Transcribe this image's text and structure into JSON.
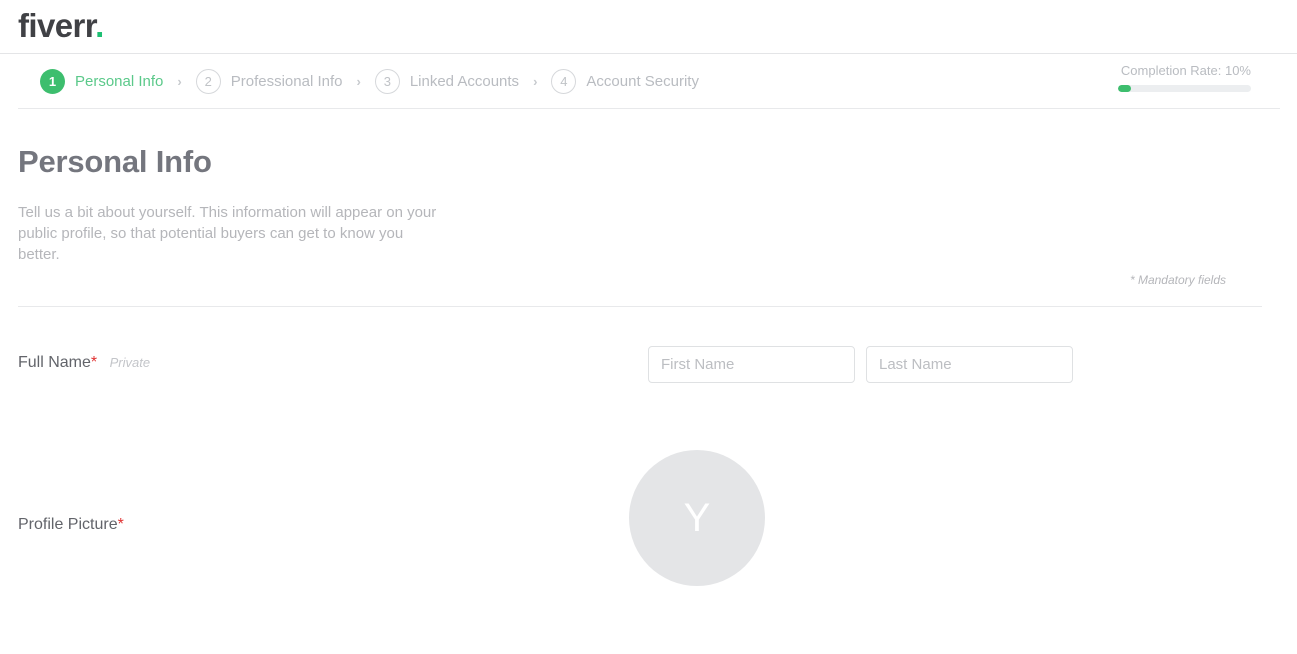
{
  "header": {
    "logo_text": "fiverr",
    "logo_dot": ".",
    "brand_green": "#1dbf73"
  },
  "steps": [
    {
      "number": "1",
      "label": "Personal Info",
      "state": "active"
    },
    {
      "number": "2",
      "label": "Professional Info",
      "state": "inactive"
    },
    {
      "number": "3",
      "label": "Linked Accounts",
      "state": "inactive"
    },
    {
      "number": "4",
      "label": "Account Security",
      "state": "inactive"
    }
  ],
  "step_separator": "›",
  "completion": {
    "label": "Completion Rate: 10%",
    "percent": 10,
    "fill_color": "#3dbe6e",
    "track_color": "#eceef0"
  },
  "main": {
    "title": "Personal Info",
    "description": "Tell us a bit about yourself. This information will appear on your public profile, so that potential buyers can get to know you better.",
    "mandatory_note": "* Mandatory fields"
  },
  "fields": {
    "full_name": {
      "label": "Full Name",
      "required_mark": "*",
      "privacy_tag": "Private",
      "first_name_placeholder": "First Name",
      "first_name_value": "",
      "last_name_placeholder": "Last Name",
      "last_name_value": ""
    },
    "profile_picture": {
      "label": "Profile Picture",
      "required_mark": "*",
      "avatar_initial": "Y",
      "avatar_bg": "#e4e5e7"
    }
  }
}
